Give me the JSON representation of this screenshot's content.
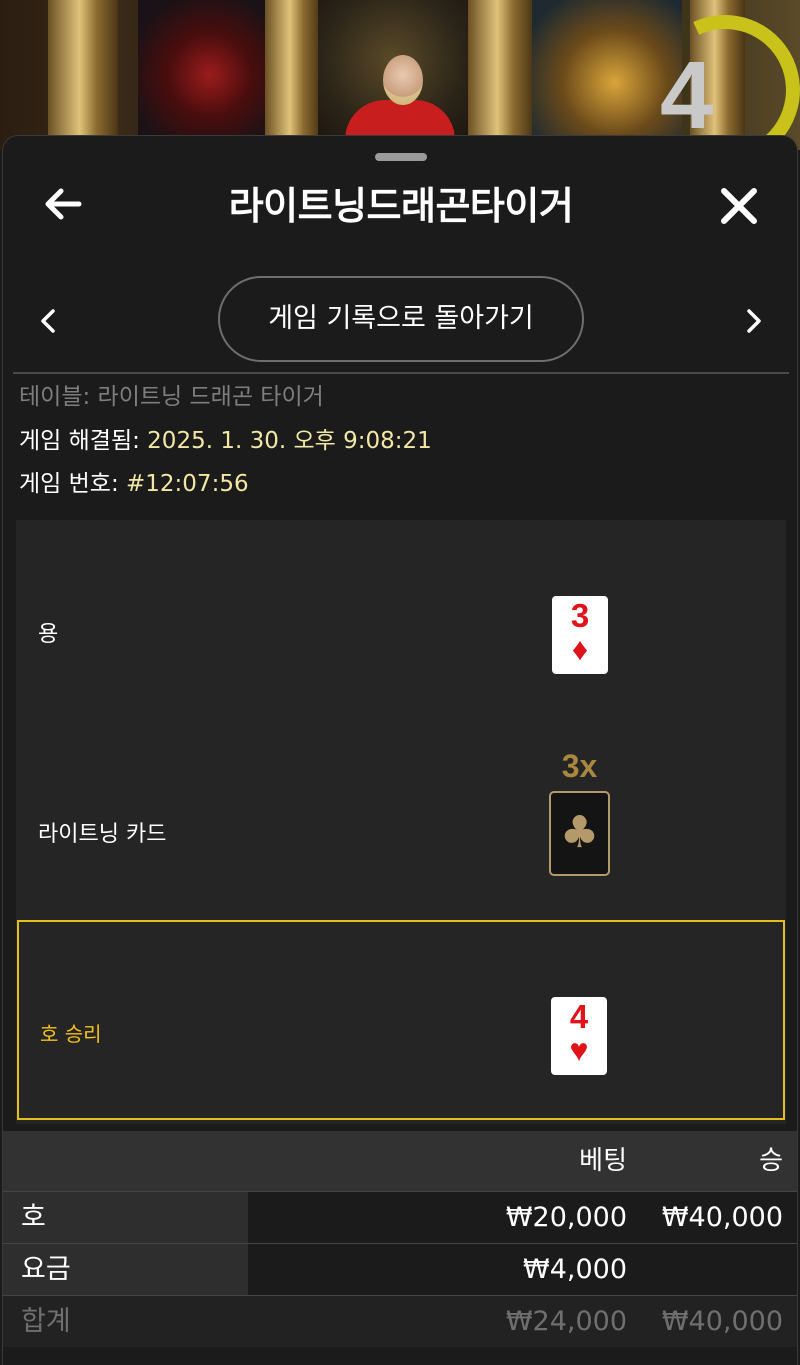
{
  "window": {
    "title": "라이트닝드래곤타이거",
    "return_label": "게임 기록으로 돌아가기",
    "timer": "4"
  },
  "details": {
    "table_label": "테이블: ",
    "table_value": "라이트닝 드래곤 타이거",
    "resolved_label": "게임 해결됨: ",
    "resolved_value": "2025. 1. 30. 오후 9:08:21",
    "game_no_label": "게임 번호: ",
    "game_no_value": "#12:07:56"
  },
  "result": {
    "dragon_label": "용",
    "dragon_card": {
      "rank": "3",
      "suit": "♦"
    },
    "lightning_label": "라이트닝 카드",
    "lightning_multiplier": "3x",
    "lightning_suit": "♣",
    "tiger_label": "호 승리",
    "tiger_card": {
      "rank": "4",
      "suit": "♥"
    }
  },
  "bets": {
    "header": {
      "bet": "베팅",
      "win": "승"
    },
    "rows": [
      {
        "name": "호",
        "bet": "₩20,000",
        "win": "₩40,000"
      },
      {
        "name": "요금",
        "bet": "₩4,000",
        "win": ""
      },
      {
        "name": "합계",
        "bet": "₩24,000",
        "win": "₩40,000"
      }
    ]
  },
  "colors": {
    "accent_gold": "#e3bf1b",
    "value_text": "#f3e7a6",
    "card_red": "#e0121a",
    "timer_ring": "#c8c21a"
  }
}
